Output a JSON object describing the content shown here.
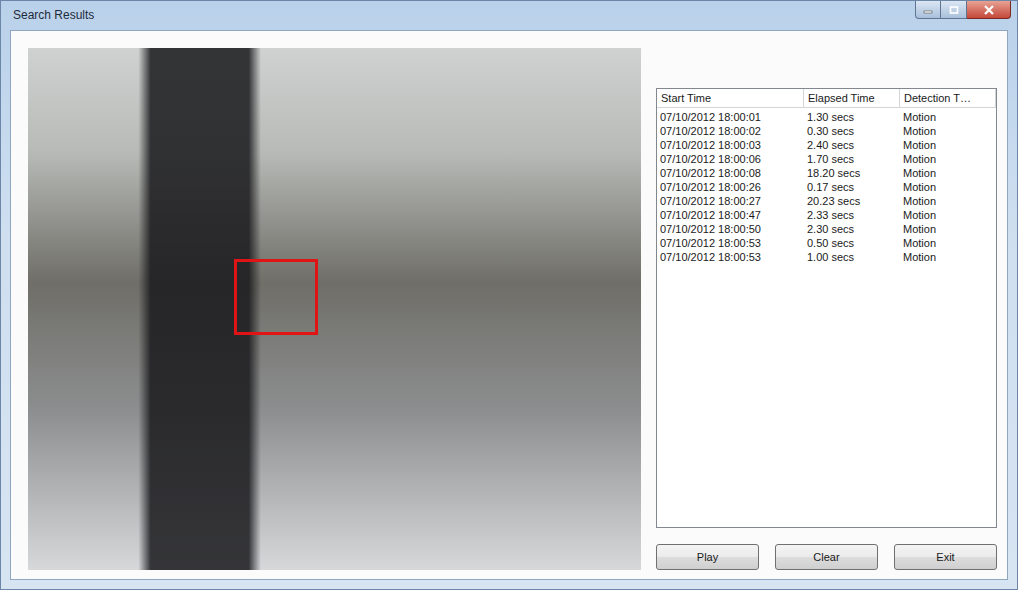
{
  "window": {
    "title": "Search Results"
  },
  "table": {
    "columns": [
      "Start Time",
      "Elapsed Time",
      "Detection T…"
    ],
    "rows": [
      {
        "start": "07/10/2012 18:00:01",
        "elapsed": "1.30 secs",
        "type": "Motion",
        "selected": false
      },
      {
        "start": "07/10/2012 18:00:02",
        "elapsed": "0.30 secs",
        "type": "Motion",
        "selected": false
      },
      {
        "start": "07/10/2012 18:00:03",
        "elapsed": "2.40 secs",
        "type": "Motion",
        "selected": false
      },
      {
        "start": "07/10/2012 18:00:06",
        "elapsed": "1.70 secs",
        "type": "Motion",
        "selected": false
      },
      {
        "start": "07/10/2012 18:00:08",
        "elapsed": "18.20 secs",
        "type": "Motion",
        "selected": false
      },
      {
        "start": "07/10/2012 18:00:26",
        "elapsed": "0.17 secs",
        "type": "Motion",
        "selected": false
      },
      {
        "start": "07/10/2012 18:00:27",
        "elapsed": "20.23 secs",
        "type": "Motion",
        "selected": false
      },
      {
        "start": "07/10/2012 18:00:47",
        "elapsed": "2.33 secs",
        "type": "Motion",
        "selected": false
      },
      {
        "start": "07/10/2012 18:00:50",
        "elapsed": "2.30 secs",
        "type": "Motion",
        "selected": false
      },
      {
        "start": "07/10/2012 18:00:53",
        "elapsed": "0.50 secs",
        "type": "Motion",
        "selected": false
      },
      {
        "start": "07/10/2012 18:00:53",
        "elapsed": "1.00 secs",
        "type": "Motion",
        "selected": false
      }
    ]
  },
  "buttons": [
    "Play",
    "Clear",
    "Exit"
  ]
}
